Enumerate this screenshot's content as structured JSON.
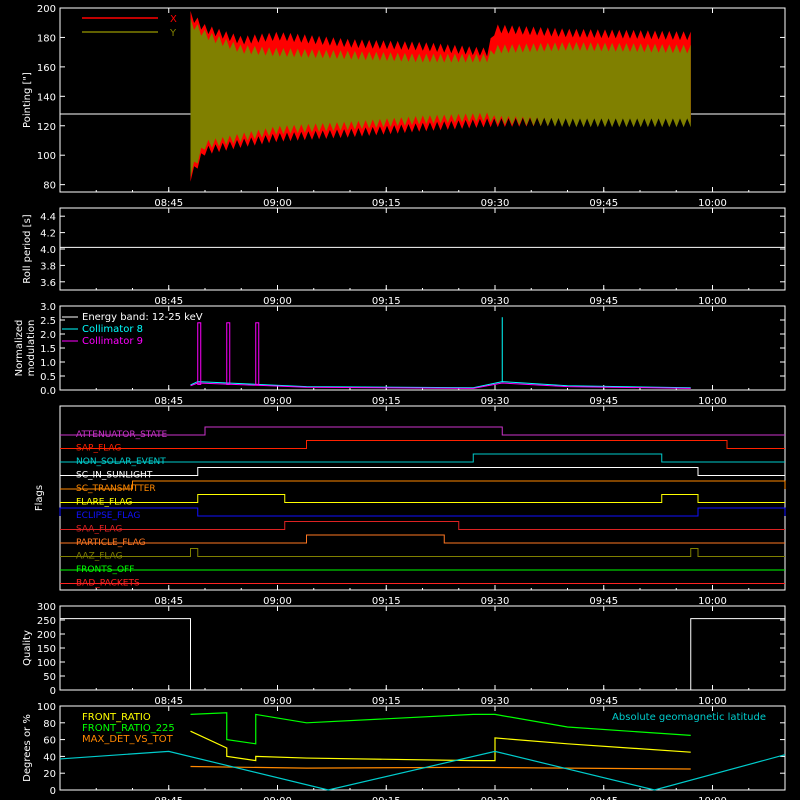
{
  "chart_data": [
    {
      "type": "line",
      "panel": "pointing",
      "ylabel": "Pointing [\"]",
      "ylim": [
        75,
        200
      ],
      "yticks": [
        "80",
        "100",
        "120",
        "140",
        "160",
        "180",
        "200"
      ],
      "xlim": [
        "08:30",
        "10:10"
      ],
      "xticks": [
        "08:45",
        "09:00",
        "09:15",
        "09:30",
        "09:45",
        "10:00"
      ],
      "legend": [
        "X",
        "Y"
      ],
      "legend_position": "top-left",
      "colors": {
        "X": "#ff0000",
        "Y": "#808000",
        "baseline": "#ffffff"
      },
      "baseline_value": 128,
      "data_window": [
        "08:48",
        "09:57"
      ],
      "series": [
        {
          "name": "X",
          "x": [
            "08:48",
            "08:50",
            "08:55",
            "09:00",
            "09:10",
            "09:20",
            "09:29",
            "09:30",
            "09:40",
            "09:50",
            "09:57"
          ],
          "upper": [
            195,
            186,
            178,
            181,
            176,
            174,
            170,
            186,
            183,
            182,
            181
          ],
          "lower": [
            85,
            103,
            108,
            112,
            115,
            119,
            122,
            122,
            123,
            124,
            125
          ]
        },
        {
          "name": "Y",
          "x": [
            "08:48",
            "08:50",
            "08:55",
            "09:00",
            "09:10",
            "09:20",
            "09:29",
            "09:30",
            "09:40",
            "09:50",
            "09:57"
          ],
          "upper": [
            190,
            182,
            172,
            170,
            168,
            166,
            166,
            172,
            174,
            173,
            172
          ],
          "lower": [
            88,
            107,
            112,
            117,
            120,
            124,
            126,
            124,
            122,
            122,
            122
          ]
        }
      ]
    },
    {
      "type": "line",
      "panel": "roll",
      "ylabel": "Roll period [s]",
      "ylim": [
        3.5,
        4.5
      ],
      "yticks": [
        "3.6",
        "3.8",
        "4.0",
        "4.2",
        "4.4"
      ],
      "xlim": [
        "08:30",
        "10:10"
      ],
      "xticks": [
        "08:45",
        "09:00",
        "09:15",
        "09:30",
        "09:45",
        "10:00"
      ],
      "series": [
        {
          "name": "Roll period",
          "x": [
            "08:30",
            "10:10"
          ],
          "y": [
            4.02,
            4.02
          ]
        }
      ]
    },
    {
      "type": "line",
      "panel": "modulation",
      "ylabel": "Normalized modulation",
      "ylim": [
        0,
        3.0
      ],
      "yticks": [
        "0.0",
        "0.5",
        "1.0",
        "1.5",
        "2.0",
        "2.5",
        "3.0"
      ],
      "xlim": [
        "08:30",
        "10:10"
      ],
      "xticks": [
        "08:45",
        "09:00",
        "09:15",
        "09:30",
        "09:45",
        "10:00"
      ],
      "legend": [
        "Energy band: 12-25 keV",
        "Collimator 8",
        "Collimator 9"
      ],
      "legend_position": "top-left",
      "colors": {
        "Collimator 8": "#00ffff",
        "Collimator 9": "#ff00ff"
      },
      "series": [
        {
          "name": "Collimator 8",
          "x": [
            "08:48",
            "08:49",
            "09:04",
            "09:27",
            "09:31",
            "09:40",
            "09:57"
          ],
          "y": [
            0.18,
            0.3,
            0.12,
            0.08,
            0.3,
            0.15,
            0.08
          ]
        },
        {
          "name": "Collimator 9",
          "x": [
            "08:48",
            "08:49",
            "09:04",
            "09:27",
            "09:31",
            "09:40",
            "09:57"
          ],
          "y": [
            0.15,
            0.25,
            0.1,
            0.06,
            0.25,
            0.12,
            0.06
          ]
        }
      ]
    },
    {
      "type": "line",
      "panel": "flags",
      "ylabel": "Flags",
      "xlim": [
        "08:30",
        "10:10"
      ],
      "xticks": [
        "08:45",
        "09:00",
        "09:15",
        "09:30",
        "09:45",
        "10:00"
      ],
      "flags": [
        {
          "name": "ATTENUATOR_STATE",
          "color": "#cc33cc",
          "on": [
            [
              "08:50",
              "09:31"
            ]
          ]
        },
        {
          "name": "SAP_FLAG",
          "color": "#ff2200",
          "on": [
            [
              "09:04",
              "10:02"
            ]
          ]
        },
        {
          "name": "NON_SOLAR_EVENT",
          "color": "#00cccc",
          "on": [
            [
              "09:27",
              "09:53"
            ]
          ]
        },
        {
          "name": "SC_IN_SUNLIGHT",
          "color": "#ffffff",
          "on": [
            [
              "08:49",
              "09:58"
            ]
          ]
        },
        {
          "name": "SC_TRANSMITTER",
          "color": "#ff8800",
          "on": [
            [
              "08:40",
              "10:10"
            ]
          ]
        },
        {
          "name": "FLARE_FLAG",
          "color": "#ffff00",
          "on": [
            [
              "08:49",
              "09:01"
            ],
            [
              "09:53",
              "09:58"
            ]
          ]
        },
        {
          "name": "ECLIPSE_FLAG",
          "color": "#1111ff",
          "on": [
            [
              "08:30",
              "08:49"
            ],
            [
              "09:58",
              "10:10"
            ]
          ]
        },
        {
          "name": "SAA_FLAG",
          "color": "#dd2222",
          "on": [
            [
              "09:01",
              "09:25"
            ]
          ]
        },
        {
          "name": "PARTICLE_FLAG",
          "color": "#ff7722",
          "on": [
            [
              "09:04",
              "09:23"
            ]
          ]
        },
        {
          "name": "AAZ_FLAG",
          "color": "#808000",
          "on": [
            [
              "08:48",
              "08:49"
            ],
            [
              "09:57",
              "09:58"
            ]
          ]
        },
        {
          "name": "FRONTS_OFF",
          "color": "#00ff00",
          "on": []
        },
        {
          "name": "BAD_PACKETS",
          "color": "#ff2222",
          "on": []
        }
      ]
    },
    {
      "type": "line",
      "panel": "quality",
      "ylabel": "Quality",
      "ylim": [
        0,
        300
      ],
      "yticks": [
        "0",
        "50",
        "100",
        "150",
        "200",
        "250",
        "300"
      ],
      "xlim": [
        "08:30",
        "10:10"
      ],
      "xticks": [
        "08:45",
        "09:00",
        "09:15",
        "09:30",
        "09:45",
        "10:00"
      ],
      "series": [
        {
          "name": "Quality",
          "x": [
            "08:30",
            "08:48",
            "08:48",
            "09:57",
            "09:57",
            "10:10"
          ],
          "y": [
            255,
            255,
            0,
            0,
            255,
            255
          ]
        }
      ]
    },
    {
      "type": "line",
      "panel": "ratios",
      "ylabel": "Degrees or %",
      "ylim": [
        0,
        100
      ],
      "yticks": [
        "0",
        "20",
        "40",
        "60",
        "80",
        "100"
      ],
      "xlim": [
        "08:30",
        "10:10"
      ],
      "xticks": [
        "08:45",
        "09:00",
        "09:15",
        "09:30",
        "09:45",
        "10:00"
      ],
      "legend": [
        "FRONT_RATIO",
        "FRONT_RATIO_225",
        "MAX_DET_VS_TOT",
        "Absolute geomagnetic latitude"
      ],
      "legend_position": "top-left",
      "colors": {
        "FRONT_RATIO": "#ffff00",
        "FRONT_RATIO_225": "#00ff00",
        "MAX_DET_VS_TOT": "#ff8800",
        "Absolute geomagnetic latitude": "#00cccc"
      },
      "series": [
        {
          "name": "FRONT_RATIO",
          "x": [
            "08:48",
            "08:53",
            "08:53",
            "08:57",
            "08:57",
            "09:04",
            "09:27",
            "09:30",
            "09:30",
            "09:40",
            "09:57"
          ],
          "y": [
            70,
            50,
            40,
            35,
            40,
            38,
            35,
            35,
            62,
            55,
            45
          ]
        },
        {
          "name": "FRONT_RATIO_225",
          "x": [
            "08:48",
            "08:53",
            "08:53",
            "08:57",
            "08:57",
            "09:04",
            "09:27",
            "09:30",
            "09:40",
            "09:57"
          ],
          "y": [
            90,
            92,
            60,
            55,
            90,
            80,
            90,
            90,
            75,
            65
          ]
        },
        {
          "name": "MAX_DET_VS_TOT",
          "x": [
            "08:48",
            "09:04",
            "09:27",
            "09:40",
            "09:57"
          ],
          "y": [
            28,
            26,
            27,
            26,
            25
          ]
        },
        {
          "name": "Absolute geomagnetic latitude",
          "x": [
            "08:30",
            "08:45",
            "09:07",
            "09:30",
            "09:52",
            "10:10"
          ],
          "y": [
            37,
            46,
            0,
            46,
            0,
            42
          ]
        }
      ]
    }
  ]
}
